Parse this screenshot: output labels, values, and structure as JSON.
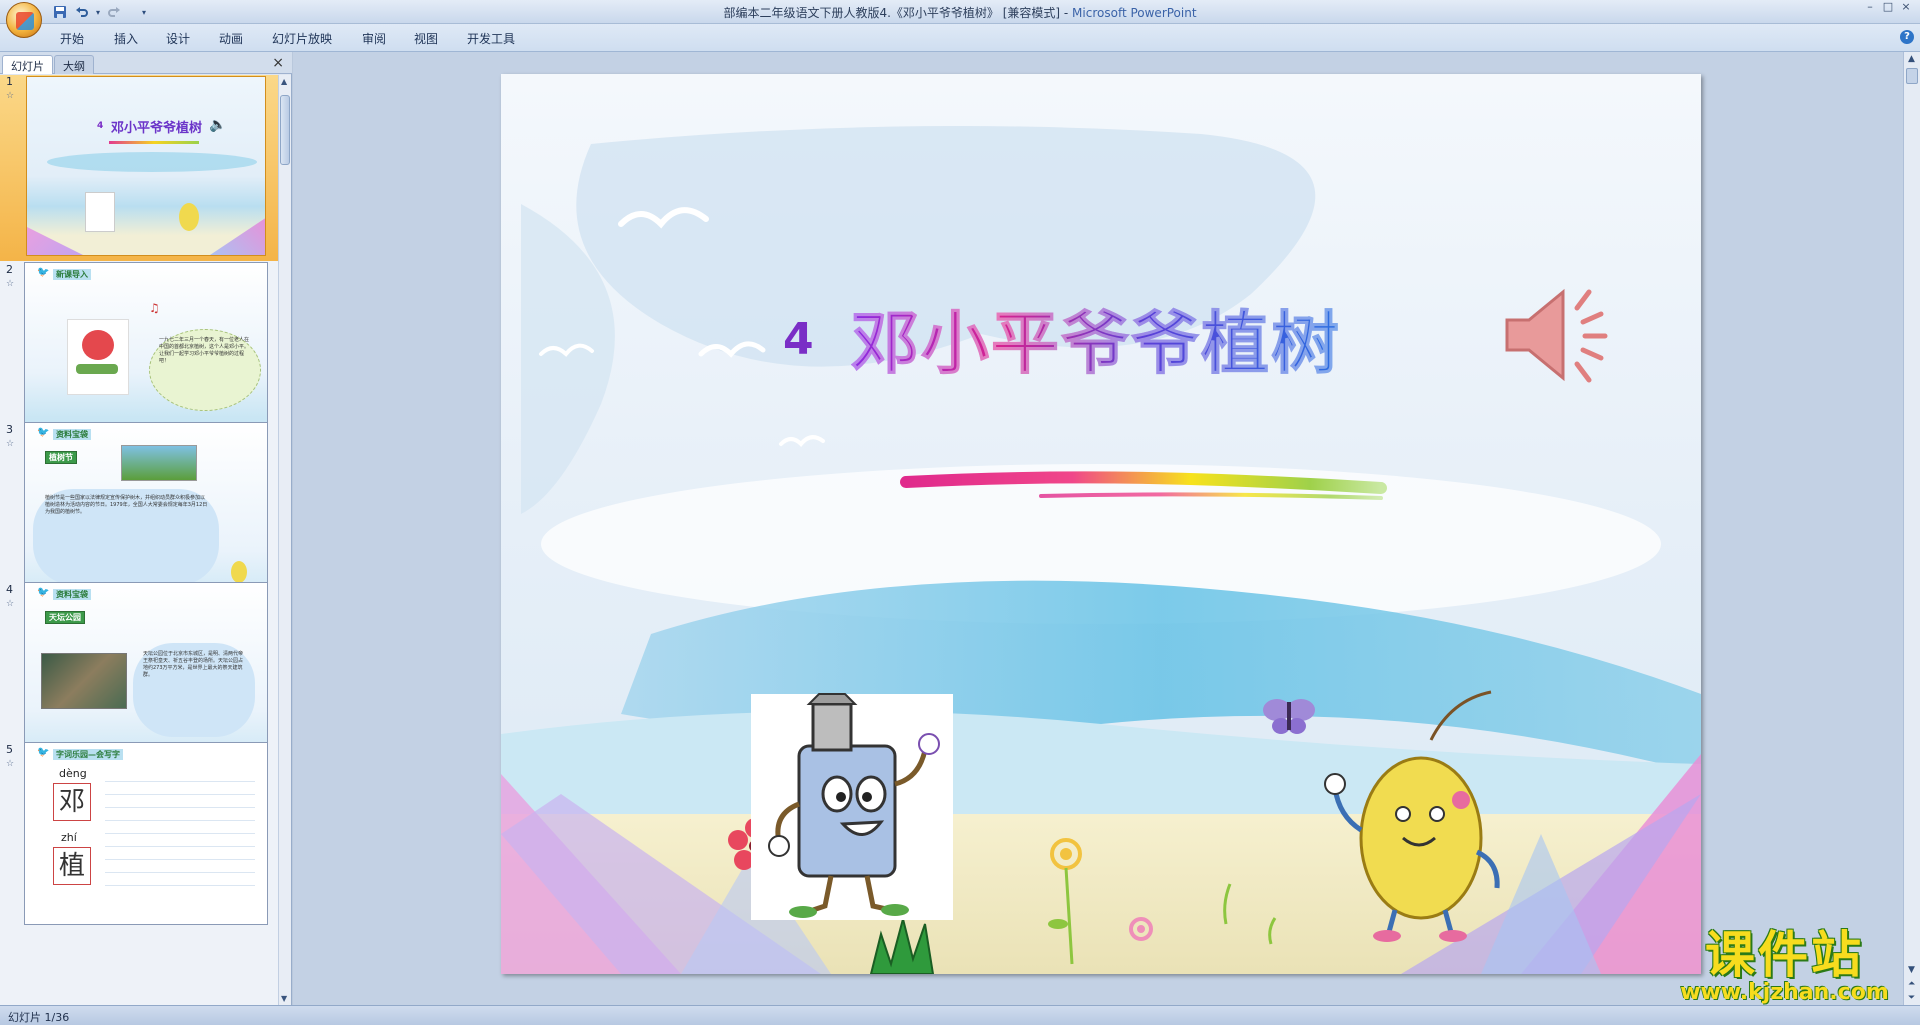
{
  "window": {
    "title_doc": "部编本二年级语文下册人教版4.《邓小平爷爷植树》 [兼容模式] - ",
    "title_app": "Microsoft PowerPoint",
    "controls": [
      "–",
      "□",
      "×"
    ]
  },
  "quick_access": {
    "save_icon": "save-icon",
    "undo_icon": "undo-icon",
    "redo_icon": "redo-icon",
    "customize_icon": "dropdown-icon"
  },
  "ribbon": {
    "tabs": [
      "开始",
      "插入",
      "设计",
      "动画",
      "幻灯片放映",
      "审阅",
      "视图",
      "开发工具"
    ],
    "help": "?"
  },
  "left_pane": {
    "tabs": [
      "幻灯片",
      "大纲"
    ],
    "close": "×",
    "thumbnails": [
      {
        "number": "1",
        "title_num": "4",
        "title": "邓小平爷爷植树"
      },
      {
        "number": "2",
        "label": "新课导入",
        "text": "一九七二年三月一个春天，有一位老人在中国的首都北京植树，这个人是邓小平。让我们一起学习邓小平爷爷植树的过程吧！"
      },
      {
        "number": "3",
        "label": "资料宝袋",
        "sub": "植树节",
        "text": "植树节是一些国家以法律规定宣传保护树木，并组织动员群众积极参加以植树造林为活动内容的节日。1979年，全国人大常委会规定每年3月12日为我国的植树节。"
      },
      {
        "number": "4",
        "label": "资料宝袋",
        "sub": "天坛公园",
        "text": "天坛公园位于北京市东城区，是明、清两代帝王祭祀皇天、祈五谷丰登的场所。天坛公园占地约273万平方米，是世界上最大的祭天建筑群。"
      },
      {
        "number": "5",
        "label": "字词乐园—会写字",
        "pinyin1": "dèng",
        "char1": "邓",
        "pinyin2": "zhí",
        "char2": "植"
      }
    ]
  },
  "slide": {
    "number": "4",
    "title": "邓小平爷爷植树",
    "speaker_icon": "speaker-icon"
  },
  "status": {
    "text": "幻灯片 1/36"
  },
  "watermark": {
    "big": "课件站",
    "url": "www.kjzhan.com"
  }
}
